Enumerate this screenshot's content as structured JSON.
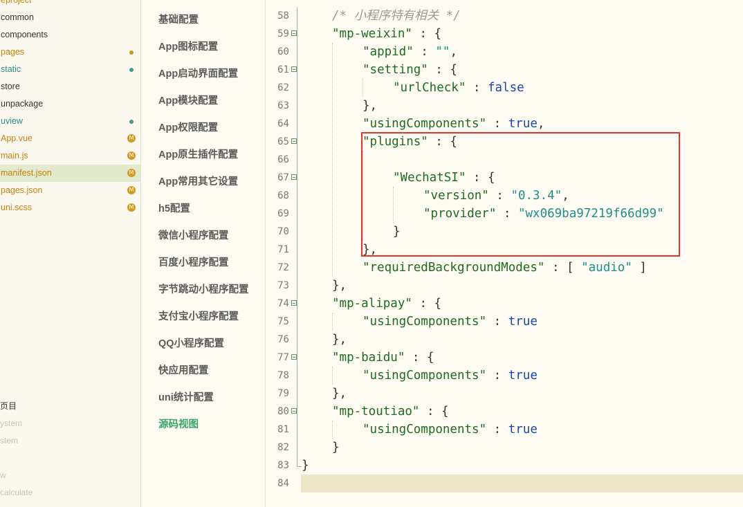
{
  "file_tree": {
    "items": [
      {
        "label": "eproject",
        "color": "orange",
        "badge": ""
      },
      {
        "label": "common",
        "color": "default",
        "badge": ""
      },
      {
        "label": "components",
        "color": "default",
        "badge": ""
      },
      {
        "label": "pages",
        "color": "orange",
        "badge": "dot-orange"
      },
      {
        "label": "static",
        "color": "teal",
        "badge": "dot-teal"
      },
      {
        "label": "store",
        "color": "default",
        "badge": ""
      },
      {
        "label": "unpackage",
        "color": "default",
        "badge": ""
      },
      {
        "label": "uview",
        "color": "teal",
        "badge": "dot-teal"
      },
      {
        "label": "App.vue",
        "color": "orange",
        "badge": "M"
      },
      {
        "label": "main.js",
        "color": "orange",
        "badge": "M"
      },
      {
        "label": "manifest.json",
        "color": "orange",
        "badge": "M",
        "selected": true
      },
      {
        "label": "pages.json",
        "color": "orange",
        "badge": "M"
      },
      {
        "label": "uni.scss",
        "color": "orange",
        "badge": "M"
      }
    ],
    "bottom_items": [
      {
        "label": "页目",
        "style": "dark"
      },
      {
        "label": "ystem",
        "style": "faded"
      },
      {
        "label": "stem",
        "style": "faded"
      },
      {
        "label": "",
        "style": "faded"
      },
      {
        "label": "w",
        "style": "faded"
      },
      {
        "label": "calculate",
        "style": "faded"
      }
    ]
  },
  "settings_nav": {
    "items": [
      {
        "label": "基础配置"
      },
      {
        "label": "App图标配置"
      },
      {
        "label": "App启动界面配置"
      },
      {
        "label": "App模块配置"
      },
      {
        "label": "App权限配置"
      },
      {
        "label": "App原生插件配置"
      },
      {
        "label": "App常用其它设置"
      },
      {
        "label": "h5配置"
      },
      {
        "label": "微信小程序配置"
      },
      {
        "label": "百度小程序配置"
      },
      {
        "label": "字节跳动小程序配置"
      },
      {
        "label": "支付宝小程序配置"
      },
      {
        "label": "QQ小程序配置"
      },
      {
        "label": "快应用配置"
      },
      {
        "label": "uni统计配置"
      },
      {
        "label": "源码视图",
        "active": true
      }
    ]
  },
  "editor": {
    "lines": [
      {
        "num": "58",
        "fold": false,
        "indent": 1,
        "tokens": [
          {
            "t": "/* 小程序特有相关 */",
            "c": "cmt"
          }
        ]
      },
      {
        "num": "59",
        "fold": true,
        "indent": 1,
        "tokens": [
          {
            "t": "\"mp-weixin\"",
            "c": "key"
          },
          {
            "t": " : {",
            "c": "pun"
          }
        ]
      },
      {
        "num": "60",
        "fold": false,
        "indent": 2,
        "tokens": [
          {
            "t": "\"appid\"",
            "c": "key"
          },
          {
            "t": " : ",
            "c": "pun"
          },
          {
            "t": "\"\"",
            "c": "str"
          },
          {
            "t": ",",
            "c": "pun"
          }
        ]
      },
      {
        "num": "61",
        "fold": true,
        "indent": 2,
        "tokens": [
          {
            "t": "\"setting\"",
            "c": "key"
          },
          {
            "t": " : {",
            "c": "pun"
          }
        ]
      },
      {
        "num": "62",
        "fold": false,
        "indent": 3,
        "tokens": [
          {
            "t": "\"urlCheck\"",
            "c": "key"
          },
          {
            "t": " : ",
            "c": "pun"
          },
          {
            "t": "false",
            "c": "kw"
          }
        ]
      },
      {
        "num": "63",
        "fold": false,
        "indent": 2,
        "tokens": [
          {
            "t": "},",
            "c": "pun"
          }
        ]
      },
      {
        "num": "64",
        "fold": false,
        "indent": 2,
        "tokens": [
          {
            "t": "\"usingComponents\"",
            "c": "key"
          },
          {
            "t": " : ",
            "c": "pun"
          },
          {
            "t": "true",
            "c": "kw"
          },
          {
            "t": ",",
            "c": "pun"
          }
        ]
      },
      {
        "num": "65",
        "fold": true,
        "indent": 2,
        "tokens": [
          {
            "t": "\"plugins\"",
            "c": "key"
          },
          {
            "t": " : {",
            "c": "pun"
          }
        ]
      },
      {
        "num": "66",
        "fold": false,
        "indent": 2,
        "tokens": []
      },
      {
        "num": "67",
        "fold": true,
        "indent": 3,
        "tokens": [
          {
            "t": "\"WechatSI\"",
            "c": "key"
          },
          {
            "t": " : {",
            "c": "pun"
          }
        ]
      },
      {
        "num": "68",
        "fold": false,
        "indent": 4,
        "tokens": [
          {
            "t": "\"version\"",
            "c": "key"
          },
          {
            "t": " : ",
            "c": "pun"
          },
          {
            "t": "\"0.3.4\"",
            "c": "str"
          },
          {
            "t": ",",
            "c": "pun"
          }
        ]
      },
      {
        "num": "69",
        "fold": false,
        "indent": 4,
        "tokens": [
          {
            "t": "\"provider\"",
            "c": "key"
          },
          {
            "t": " : ",
            "c": "pun"
          },
          {
            "t": "\"wx069ba97219f66d99\"",
            "c": "str"
          }
        ]
      },
      {
        "num": "70",
        "fold": false,
        "indent": 3,
        "tokens": [
          {
            "t": "}",
            "c": "pun"
          }
        ]
      },
      {
        "num": "71",
        "fold": false,
        "indent": 2,
        "tokens": [
          {
            "t": "},",
            "c": "pun"
          }
        ]
      },
      {
        "num": "72",
        "fold": false,
        "indent": 2,
        "tokens": [
          {
            "t": "\"requiredBackgroundModes\"",
            "c": "key"
          },
          {
            "t": " : [ ",
            "c": "pun"
          },
          {
            "t": "\"audio\"",
            "c": "str"
          },
          {
            "t": " ]",
            "c": "pun"
          }
        ]
      },
      {
        "num": "73",
        "fold": false,
        "indent": 1,
        "tokens": [
          {
            "t": "},",
            "c": "pun"
          }
        ]
      },
      {
        "num": "74",
        "fold": true,
        "indent": 1,
        "tokens": [
          {
            "t": "\"mp-alipay\"",
            "c": "key"
          },
          {
            "t": " : {",
            "c": "pun"
          }
        ]
      },
      {
        "num": "75",
        "fold": false,
        "indent": 2,
        "tokens": [
          {
            "t": "\"usingComponents\"",
            "c": "key"
          },
          {
            "t": " : ",
            "c": "pun"
          },
          {
            "t": "true",
            "c": "kw"
          }
        ]
      },
      {
        "num": "76",
        "fold": false,
        "indent": 1,
        "tokens": [
          {
            "t": "},",
            "c": "pun"
          }
        ]
      },
      {
        "num": "77",
        "fold": true,
        "indent": 1,
        "tokens": [
          {
            "t": "\"mp-baidu\"",
            "c": "key"
          },
          {
            "t": " : {",
            "c": "pun"
          }
        ]
      },
      {
        "num": "78",
        "fold": false,
        "indent": 2,
        "tokens": [
          {
            "t": "\"usingComponents\"",
            "c": "key"
          },
          {
            "t": " : ",
            "c": "pun"
          },
          {
            "t": "true",
            "c": "kw"
          }
        ]
      },
      {
        "num": "79",
        "fold": false,
        "indent": 1,
        "tokens": [
          {
            "t": "},",
            "c": "pun"
          }
        ]
      },
      {
        "num": "80",
        "fold": true,
        "indent": 1,
        "tokens": [
          {
            "t": "\"mp-toutiao\"",
            "c": "key"
          },
          {
            "t": " : {",
            "c": "pun"
          }
        ]
      },
      {
        "num": "81",
        "fold": false,
        "indent": 2,
        "tokens": [
          {
            "t": "\"usingComponents\"",
            "c": "key"
          },
          {
            "t": " : ",
            "c": "pun"
          },
          {
            "t": "true",
            "c": "kw"
          }
        ]
      },
      {
        "num": "82",
        "fold": false,
        "indent": 1,
        "tokens": [
          {
            "t": "}",
            "c": "pun"
          }
        ]
      },
      {
        "num": "83",
        "fold": false,
        "indent": 0,
        "tokens": [
          {
            "t": "}",
            "c": "pun"
          }
        ]
      },
      {
        "num": "84",
        "fold": false,
        "indent": 0,
        "tokens": [],
        "current": true
      }
    ],
    "highlighted_lines": [
      "65",
      "71"
    ]
  },
  "colors": {
    "json_key": "#1f6b1f",
    "json_string": "#1f8f8a",
    "json_keyword": "#1c47a8",
    "comment": "#9a9a9a",
    "nav_active": "#3aa46a",
    "modified_badge": "#d19a22",
    "highlight_box": "#e8322b"
  }
}
